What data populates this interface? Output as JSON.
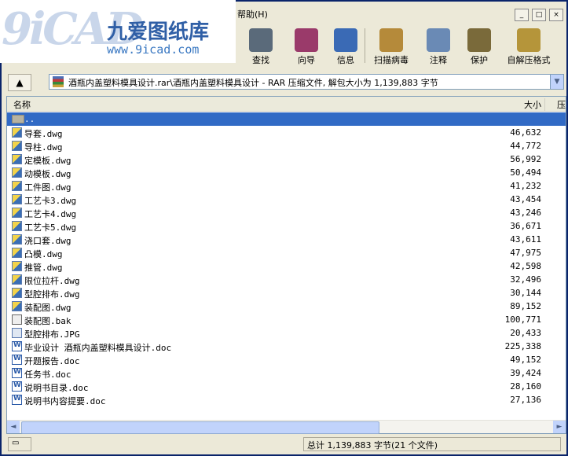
{
  "menu": {
    "help": "帮助(H)"
  },
  "logo": {
    "big": "9iCAD",
    "cn": "九爱图纸库",
    "url": "www.9icad.com"
  },
  "toolbar": [
    {
      "label": "查找",
      "color": "#5a6a7a"
    },
    {
      "label": "向导",
      "color": "#9a3a6a"
    },
    {
      "label": "信息",
      "color": "#3a6ab5"
    },
    {
      "label": "扫描病毒",
      "color": "#b58a3a"
    },
    {
      "label": "注释",
      "color": "#6a8ab5"
    },
    {
      "label": "保护",
      "color": "#7a6a3a"
    },
    {
      "label": "自解压格式",
      "color": "#b5953a"
    }
  ],
  "address": {
    "path": "酒瓶内盖塑料模具设计.rar\\酒瓶内盖塑料模具设计 - RAR 压缩文件, 解包大小为 1,139,883 字节"
  },
  "columns": {
    "name": "名称",
    "size": "大小",
    "packed": "压"
  },
  "files": [
    {
      "name": "..",
      "size": "",
      "type": "folder",
      "selected": true
    },
    {
      "name": "导套.dwg",
      "size": "46,632",
      "type": "dwg"
    },
    {
      "name": "导柱.dwg",
      "size": "44,772",
      "type": "dwg"
    },
    {
      "name": "定模板.dwg",
      "size": "56,992",
      "type": "dwg"
    },
    {
      "name": "动模板.dwg",
      "size": "50,494",
      "type": "dwg"
    },
    {
      "name": "工件图.dwg",
      "size": "41,232",
      "type": "dwg"
    },
    {
      "name": "工艺卡3.dwg",
      "size": "43,454",
      "type": "dwg"
    },
    {
      "name": "工艺卡4.dwg",
      "size": "43,246",
      "type": "dwg"
    },
    {
      "name": "工艺卡5.dwg",
      "size": "36,671",
      "type": "dwg"
    },
    {
      "name": "浇口套.dwg",
      "size": "43,611",
      "type": "dwg"
    },
    {
      "name": "凸模.dwg",
      "size": "47,975",
      "type": "dwg"
    },
    {
      "name": "推管.dwg",
      "size": "42,598",
      "type": "dwg"
    },
    {
      "name": "限位拉杆.dwg",
      "size": "32,496",
      "type": "dwg"
    },
    {
      "name": "型腔排布.dwg",
      "size": "30,144",
      "type": "dwg"
    },
    {
      "name": "装配图.dwg",
      "size": "89,152",
      "type": "dwg"
    },
    {
      "name": "装配图.bak",
      "size": "100,771",
      "type": "bak"
    },
    {
      "name": "型腔排布.JPG",
      "size": "20,433",
      "type": "jpg"
    },
    {
      "name": "毕业设计 酒瓶内盖塑料模具设计.doc",
      "size": "225,338",
      "type": "doc"
    },
    {
      "name": "开题报告.doc",
      "size": "49,152",
      "type": "doc"
    },
    {
      "name": "任务书.doc",
      "size": "39,424",
      "type": "doc"
    },
    {
      "name": "说明书目录.doc",
      "size": "28,160",
      "type": "doc"
    },
    {
      "name": "说明书内容提要.doc",
      "size": "27,136",
      "type": "doc"
    }
  ],
  "status": {
    "total": "总计 1,139,883 字节(21 个文件)"
  }
}
